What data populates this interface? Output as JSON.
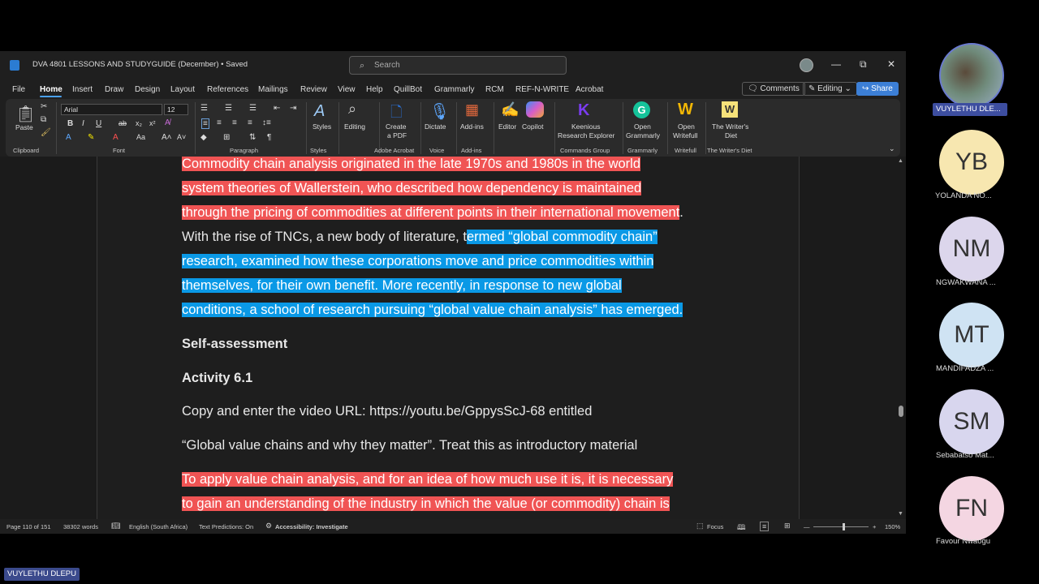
{
  "window": {
    "title": "DVA 4801 LESSONS AND STUDYGUIDE (December) • Saved",
    "search_placeholder": "Search"
  },
  "menu": [
    "File",
    "Home",
    "Insert",
    "Draw",
    "Design",
    "Layout",
    "References",
    "Mailings",
    "Review",
    "View",
    "Help",
    "QuillBot",
    "Grammarly",
    "RCM",
    "REF-N-WRITE",
    "Acrobat"
  ],
  "actions": {
    "comments": "Comments",
    "editing": "Editing",
    "share": "Share"
  },
  "ribbon": {
    "clipboard": {
      "paste": "Paste",
      "label": "Clipboard"
    },
    "font": {
      "name": "Arial",
      "size": "12",
      "label": "Font"
    },
    "paragraph_label": "Paragraph",
    "styles": {
      "button": "Styles",
      "label": "Styles"
    },
    "editing": "Editing",
    "acrobat": {
      "button_line1": "Create",
      "button_line2": "a PDF",
      "label": "Adobe Acrobat"
    },
    "voice": {
      "button": "Dictate",
      "label": "Voice"
    },
    "addins": {
      "button": "Add-ins",
      "label": "Add-ins"
    },
    "editor": "Editor",
    "copilot": "Copilot",
    "keenious": {
      "line1": "Keenious",
      "line2": "Research Explorer",
      "label": "Commands Group"
    },
    "grammarly": {
      "line1": "Open",
      "line2": "Grammarly",
      "label": "Grammarly"
    },
    "writefull": {
      "line1": "Open",
      "line2": "Writefull",
      "label": "Writefull"
    },
    "writers_diet": {
      "line1": "The Writer's",
      "line2": "Diet",
      "label": "The Writer's Diet"
    }
  },
  "document": {
    "red_lines_1": [
      "Commodity chain analysis originated in the late 1970s and 1980s in the world",
      "system theories of Wallerstein, who described how dependency is maintained",
      "through the pricing of commodities at different points in their international movement"
    ],
    "period": ".",
    "mixed_plain": "With the rise of TNCs, a new body of literature, t",
    "mixed_blue": "ermed “global commodity chain”",
    "blue_lines": [
      "research, examined how these corporations move and price commodities within",
      "themselves, for their own benefit. More recently, in response to new global",
      "conditions, a school of research pursuing “global value chain analysis” has emerged."
    ],
    "heading_1": "Self-assessment",
    "heading_2": "Activity 6.1",
    "para_1": "Copy and enter the video URL: https://youtu.be/GppysScJ-68 entitled",
    "para_2": "“Global value chains and why they matter”. Treat this as introductory material",
    "red_lines_2": [
      "To apply value chain analysis, and for an idea of how much use it is, it is necessary",
      "to gain an understanding of the industry in which the value (or commodity) chain is"
    ]
  },
  "status": {
    "page": "Page 110 of 151",
    "words": "38302 words",
    "language": "English (South Africa)",
    "predictions": "Text Predictions: On",
    "accessibility": "Accessibility: Investigate",
    "focus": "Focus",
    "zoom": "150%"
  },
  "participants": [
    {
      "initials": "",
      "name": "VUYLETHU DLE...",
      "color": "#6f8a7a"
    },
    {
      "initials": "YB",
      "name": "YOLANDA NO...",
      "color": "#f7e7b0"
    },
    {
      "initials": "NM",
      "name": "NGWAKWANA ...",
      "color": "#dcd6ec"
    },
    {
      "initials": "MT",
      "name": "MANDIFADZA ...",
      "color": "#cfe3f3"
    },
    {
      "initials": "SM",
      "name": "Sebabatso Mat...",
      "color": "#d8d6ee"
    },
    {
      "initials": "FN",
      "name": "Favour  Nwaogu",
      "color": "#f4d6e2"
    }
  ],
  "self_label": "VUYLETHU DLEPU"
}
